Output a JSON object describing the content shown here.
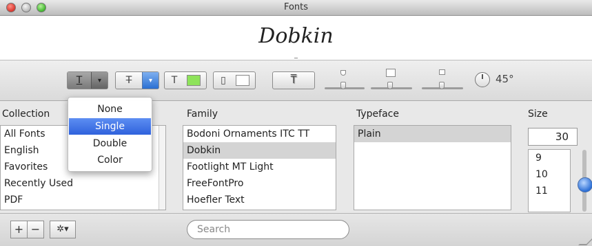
{
  "window": {
    "title": "Fonts"
  },
  "preview": {
    "text": "Dobkin"
  },
  "toolbar": {
    "underline_glyph": "T",
    "strike_glyph": "T",
    "text_color_glyph": "T",
    "doc_color_glyph": "▯",
    "shadow_glyph": "T",
    "angle_label": "45°",
    "arrow": "▾"
  },
  "menu": {
    "items": [
      "None",
      "Single",
      "Double",
      "Color"
    ],
    "selected": "Single"
  },
  "columns": {
    "collections": {
      "header": "Collection",
      "items": [
        "All Fonts",
        "English",
        "Favorites",
        "Recently Used",
        "PDF"
      ],
      "selected": "All Fonts"
    },
    "family": {
      "header": "Family",
      "items": [
        "Bodoni Ornaments ITC TT",
        "Dobkin",
        "Footlight MT Light",
        "FreeFontPro",
        "Hoefler Text"
      ],
      "selected": "Dobkin"
    },
    "typeface": {
      "header": "Typeface",
      "items": [
        "Plain"
      ],
      "selected": "Plain"
    },
    "size": {
      "header": "Size",
      "value": "30",
      "items": [
        "9",
        "10",
        "11"
      ]
    }
  },
  "bottom": {
    "add_label": "+",
    "remove_label": "−",
    "action_label": "✲▾",
    "search_placeholder": "Search"
  },
  "colors": {
    "accent": "#2f62dc",
    "text_color_swatch": "#8ee35a",
    "doc_color_swatch": "#ffffff"
  }
}
